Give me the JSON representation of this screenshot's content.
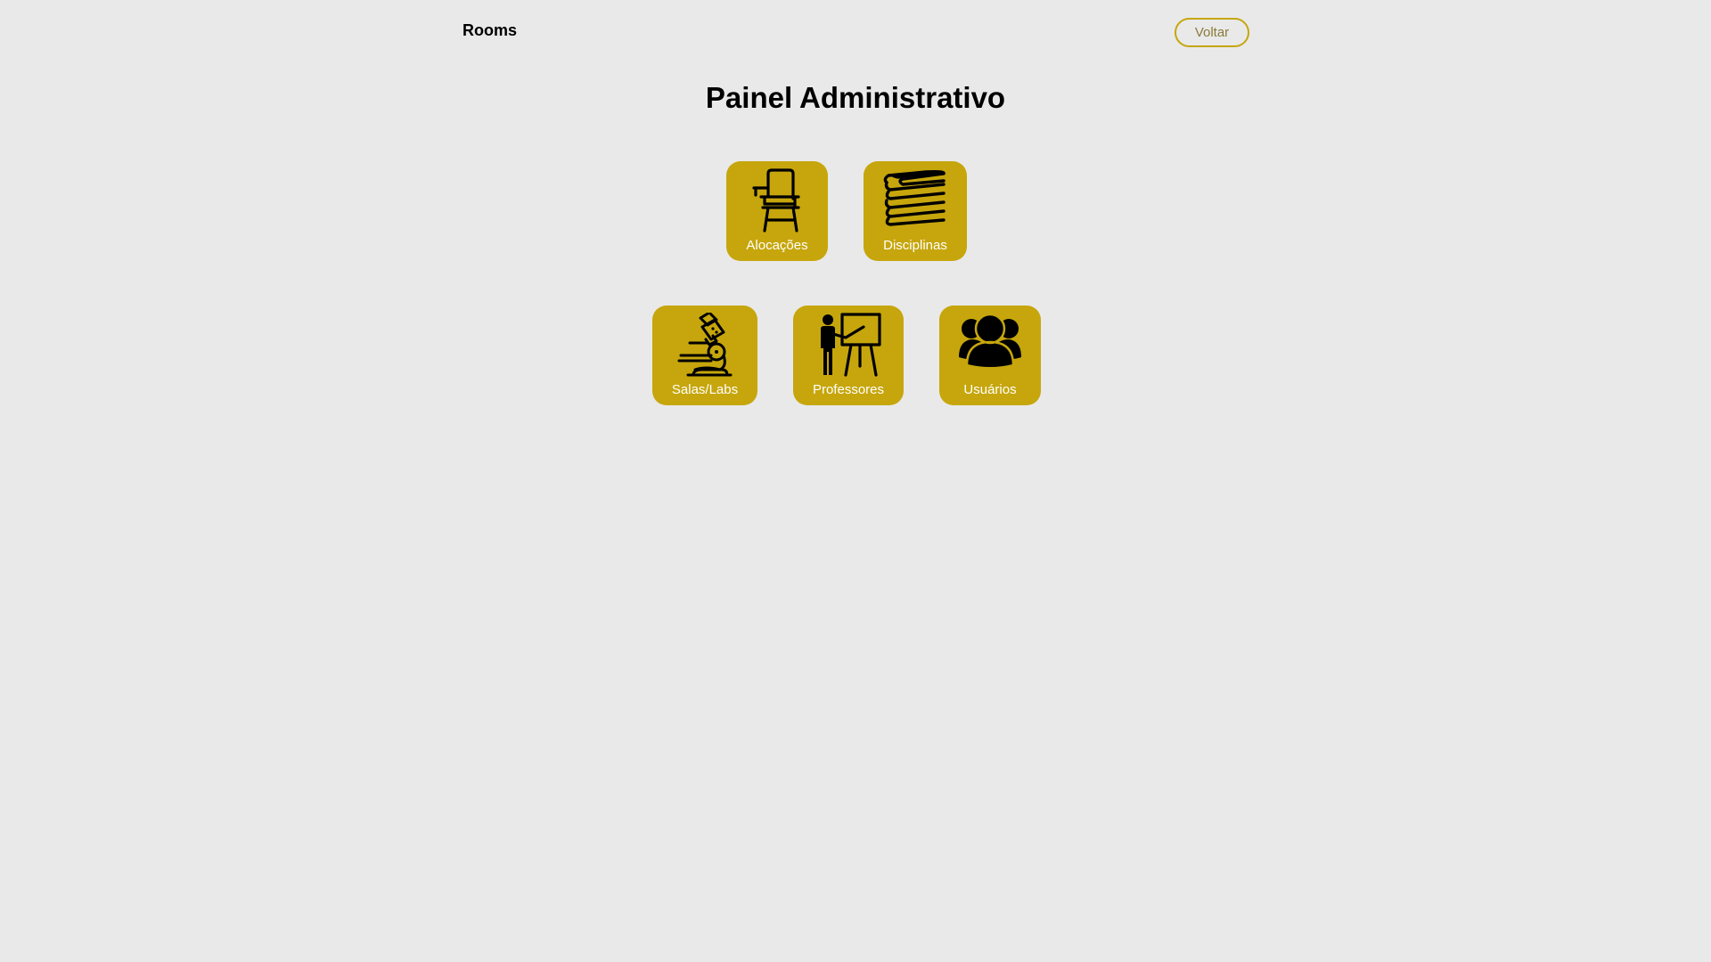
{
  "header": {
    "brand": "Rooms",
    "back_label": "Voltar"
  },
  "main": {
    "title": "Painel Administrativo",
    "tiles": [
      {
        "label": "Alocações",
        "icon": "school-desk-icon"
      },
      {
        "label": "Disciplinas",
        "icon": "books-stack-icon"
      },
      {
        "label": "Salas/Labs",
        "icon": "microscope-icon"
      },
      {
        "label": "Professores",
        "icon": "teacher-board-icon"
      },
      {
        "label": "Usuários",
        "icon": "users-group-icon"
      }
    ]
  },
  "colors": {
    "background": "#e9e9e9",
    "accent": "#c6a60c",
    "tile_text": "#ffffff"
  }
}
